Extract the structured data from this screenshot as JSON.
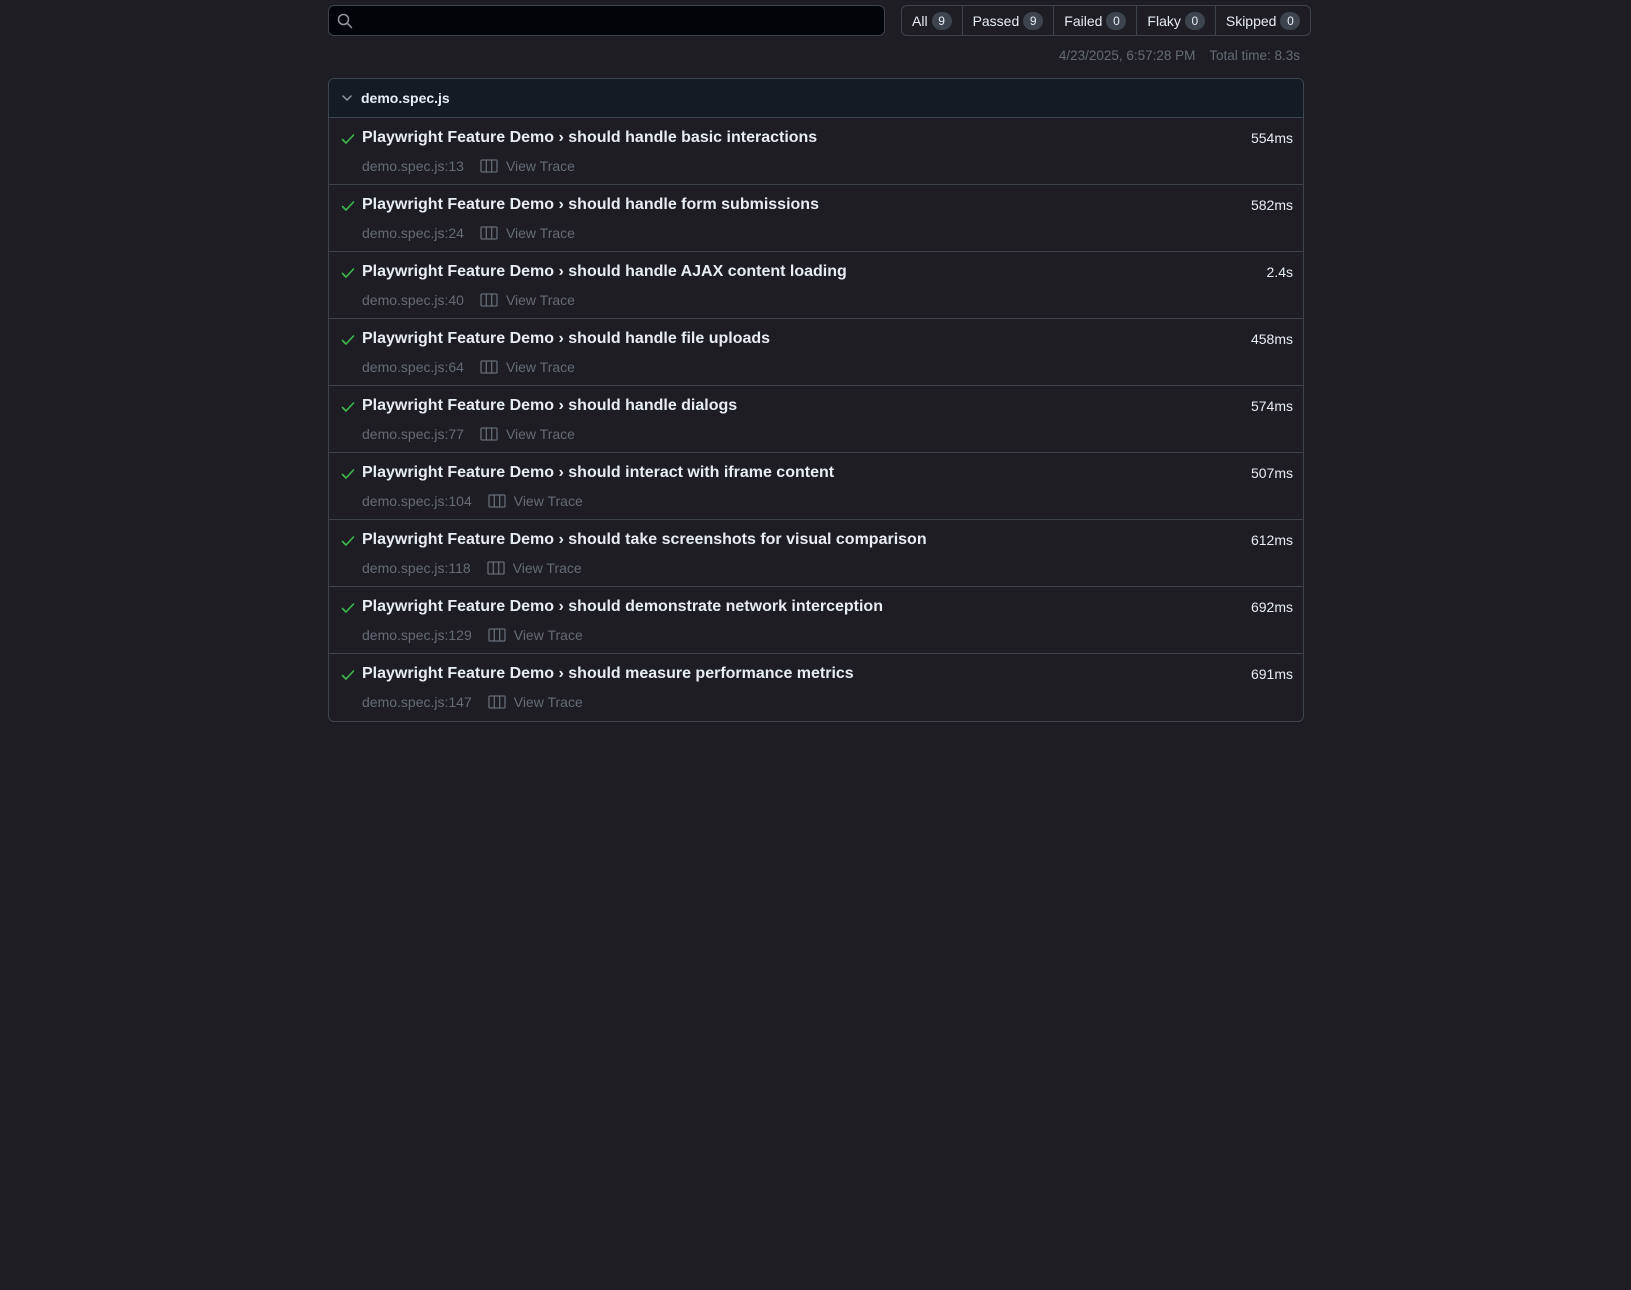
{
  "search": {
    "value": "",
    "placeholder": ""
  },
  "filters": [
    {
      "label": "All",
      "count": "9"
    },
    {
      "label": "Passed",
      "count": "9"
    },
    {
      "label": "Failed",
      "count": "0"
    },
    {
      "label": "Flaky",
      "count": "0"
    },
    {
      "label": "Skipped",
      "count": "0"
    }
  ],
  "meta": {
    "timestamp": "4/23/2025, 6:57:28 PM",
    "total_time": "Total time: 8.3s"
  },
  "file": {
    "name": "demo.spec.js"
  },
  "tests": [
    {
      "title": "Playwright Feature Demo › should handle basic interactions",
      "location": "demo.spec.js:13",
      "trace_label": "View Trace",
      "duration": "554ms",
      "status": "passed"
    },
    {
      "title": "Playwright Feature Demo › should handle form submissions",
      "location": "demo.spec.js:24",
      "trace_label": "View Trace",
      "duration": "582ms",
      "status": "passed"
    },
    {
      "title": "Playwright Feature Demo › should handle AJAX content loading",
      "location": "demo.spec.js:40",
      "trace_label": "View Trace",
      "duration": "2.4s",
      "status": "passed"
    },
    {
      "title": "Playwright Feature Demo › should handle file uploads",
      "location": "demo.spec.js:64",
      "trace_label": "View Trace",
      "duration": "458ms",
      "status": "passed"
    },
    {
      "title": "Playwright Feature Demo › should handle dialogs",
      "location": "demo.spec.js:77",
      "trace_label": "View Trace",
      "duration": "574ms",
      "status": "passed"
    },
    {
      "title": "Playwright Feature Demo › should interact with iframe content",
      "location": "demo.spec.js:104",
      "trace_label": "View Trace",
      "duration": "507ms",
      "status": "passed"
    },
    {
      "title": "Playwright Feature Demo › should take screenshots for visual comparison",
      "location": "demo.spec.js:118",
      "trace_label": "View Trace",
      "duration": "612ms",
      "status": "passed"
    },
    {
      "title": "Playwright Feature Demo › should demonstrate network interception",
      "location": "demo.spec.js:129",
      "trace_label": "View Trace",
      "duration": "692ms",
      "status": "passed"
    },
    {
      "title": "Playwright Feature Demo › should measure performance metrics",
      "location": "demo.spec.js:147",
      "trace_label": "View Trace",
      "duration": "691ms",
      "status": "passed"
    }
  ],
  "colors": {
    "background": "#1d1d23",
    "pass": "#3fb950",
    "border": "#3d444d",
    "muted": "#656c76"
  },
  "icons": {
    "search": "search-icon",
    "chevron": "chevron-down-icon",
    "check": "check-icon",
    "trace": "trace-icon"
  }
}
